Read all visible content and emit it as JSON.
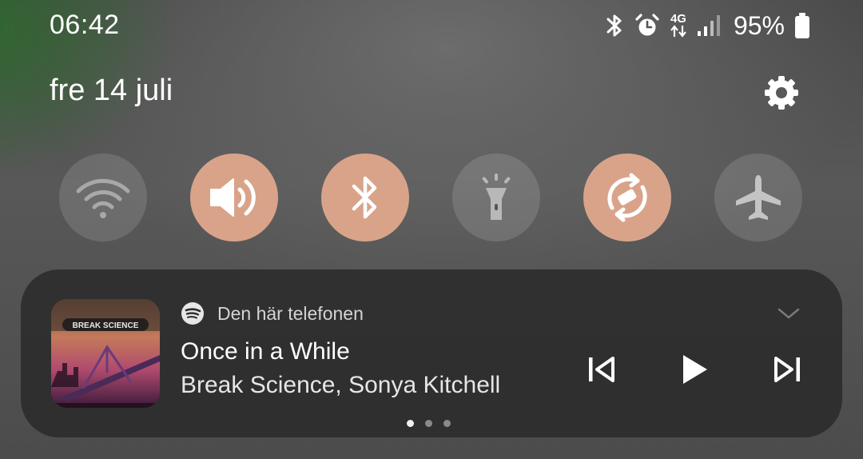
{
  "status_bar": {
    "time": "06:42",
    "network_type": "4G",
    "battery_percent": "95%",
    "icons": [
      "bluetooth-icon",
      "alarm-icon",
      "data-arrows-icon",
      "signal-icon",
      "battery-icon"
    ]
  },
  "header": {
    "date": "fre 14 juli",
    "settings_icon": "gear-icon"
  },
  "quick_toggles": [
    {
      "name": "wifi",
      "icon": "wifi-icon",
      "state": "off"
    },
    {
      "name": "sound",
      "icon": "speaker-icon",
      "state": "on"
    },
    {
      "name": "bluetooth",
      "icon": "bluetooth-icon",
      "state": "on"
    },
    {
      "name": "flashlight",
      "icon": "flashlight-icon",
      "state": "off"
    },
    {
      "name": "auto-rotate",
      "icon": "rotate-icon",
      "state": "on"
    },
    {
      "name": "airplane-mode",
      "icon": "airplane-icon",
      "state": "off"
    }
  ],
  "colors": {
    "toggle_on": "#d9a38a",
    "toggle_off": "rgba(255,255,255,0.13)",
    "media_card": "#2a2a2a"
  },
  "media": {
    "source": "Den här telefonen",
    "app_icon": "spotify-icon",
    "title": "Once in a While",
    "artist": "Break Science, Sonya Kitchell",
    "album_art_text": "BREAK SCIENCE",
    "controls": [
      "previous-icon",
      "play-icon",
      "next-icon"
    ],
    "page_indicator": {
      "count": 3,
      "active": 1
    }
  }
}
